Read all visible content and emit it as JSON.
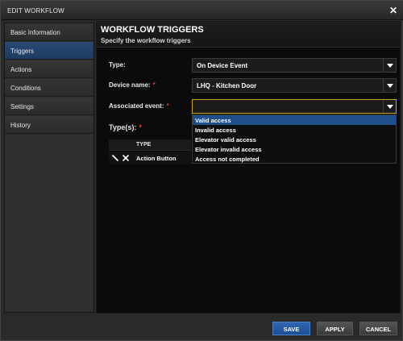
{
  "window": {
    "title": "EDIT WORKFLOW"
  },
  "sidebar": {
    "items": [
      {
        "label": "Basic Information"
      },
      {
        "label": "Triggers"
      },
      {
        "label": "Actions"
      },
      {
        "label": "Conditions"
      },
      {
        "label": "Settings"
      },
      {
        "label": "History"
      }
    ],
    "active_index": 1
  },
  "main": {
    "title": "WORKFLOW TRIGGERS",
    "subtitle": "Specify the workflow triggers"
  },
  "form": {
    "type_label": "Type:",
    "type_value": "On Device Event",
    "device_label": "Device name:",
    "device_value": "LHQ - Kitchen Door",
    "event_label": "Associated event:",
    "event_value": "",
    "types_label": "Type(s):",
    "required_marker": "*"
  },
  "event_options": [
    {
      "label": "Valid access",
      "selected": true
    },
    {
      "label": "Invalid access",
      "selected": false
    },
    {
      "label": "Elevator valid access",
      "selected": false
    },
    {
      "label": "Elevator invalid access",
      "selected": false
    },
    {
      "label": "Access not completed",
      "selected": false
    }
  ],
  "types_table": {
    "header": "TYPE",
    "rows": [
      {
        "type": "Action Button"
      }
    ]
  },
  "footer": {
    "save": "SAVE",
    "apply": "APPLY",
    "cancel": "CANCEL"
  },
  "colors": {
    "accent": "#1f4f8a",
    "required": "#e03a3a",
    "focus_border": "#c9a227",
    "save_button": "#2f66b3"
  }
}
